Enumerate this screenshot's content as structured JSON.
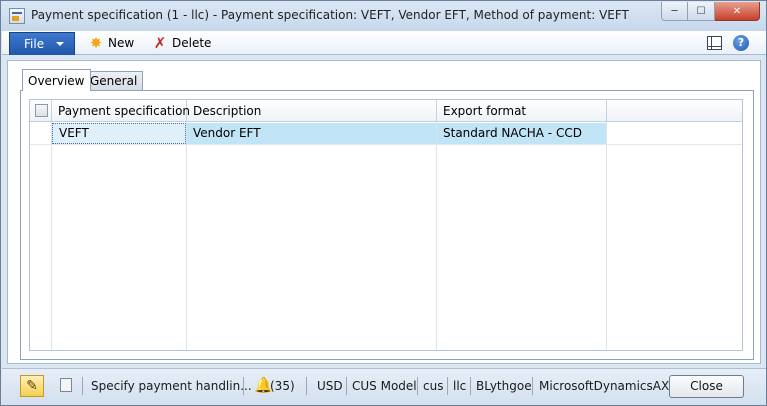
{
  "window": {
    "title": "Payment specification (1 - llc) - Payment specification: VEFT, Vendor EFT, Method of payment: VEFT",
    "caption_buttons": [
      "─",
      "☐",
      "✕"
    ]
  },
  "actionbar": {
    "file_label": "File",
    "new_label": "New",
    "delete_label": "Delete",
    "new_icon": "sun-star-icon",
    "delete_icon": "x-delete-icon"
  },
  "tabs": [
    {
      "label": "Overview",
      "active": true
    },
    {
      "label": "General",
      "active": false
    }
  ],
  "grid": {
    "columns": [
      "Payment specification",
      "Description",
      "Export format"
    ],
    "rows": [
      [
        "VEFT",
        "Vendor EFT",
        "Standard NACHA - CCD"
      ]
    ]
  },
  "statusbar": {
    "help_text": "Specify payment handlin...",
    "notifications": "(35)",
    "currency": "USD",
    "model": "CUS Model",
    "layer": "cus",
    "company": "llc",
    "user": "BLythgoe",
    "partition": "MicrosoftDynamicsAX",
    "close_label": "Close"
  },
  "colors": {
    "accent": "#1f56a8",
    "selection": "#c2e4f7"
  }
}
